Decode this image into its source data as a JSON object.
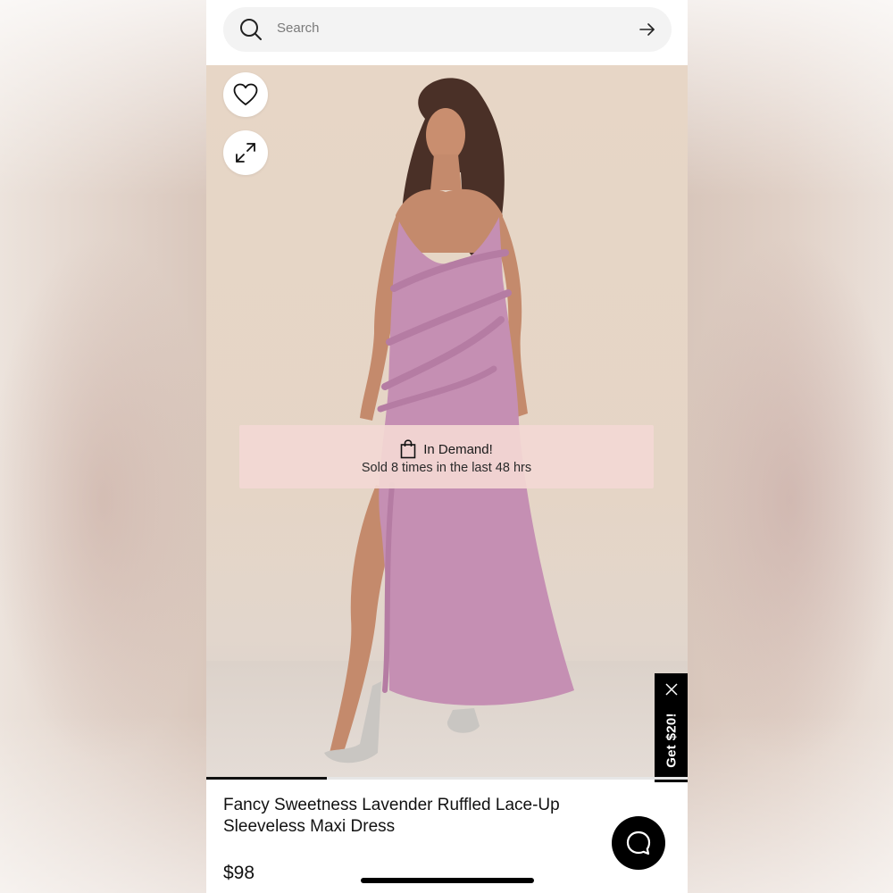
{
  "search": {
    "placeholder": "Search",
    "icon": "search-icon",
    "submit_icon": "arrow-right-icon"
  },
  "gallery": {
    "favorite_icon": "heart-icon",
    "expand_icon": "expand-icon",
    "progress": 0.25
  },
  "demand_banner": {
    "icon": "shopping-bag-icon",
    "title": "In Demand!",
    "subtitle": "Sold 8 times in the last 48 hrs"
  },
  "promo_tab": {
    "label": "Get $20!",
    "close_icon": "close-icon"
  },
  "product": {
    "name": "Fancy Sweetness Lavender Ruffled Lace-Up Sleeveless Maxi Dress",
    "price": "$98"
  },
  "chat": {
    "icon": "chat-bubble-icon"
  },
  "colors": {
    "dress": "#c58fb3",
    "banner": "#f3d8d4",
    "promo_bg": "#000000"
  }
}
